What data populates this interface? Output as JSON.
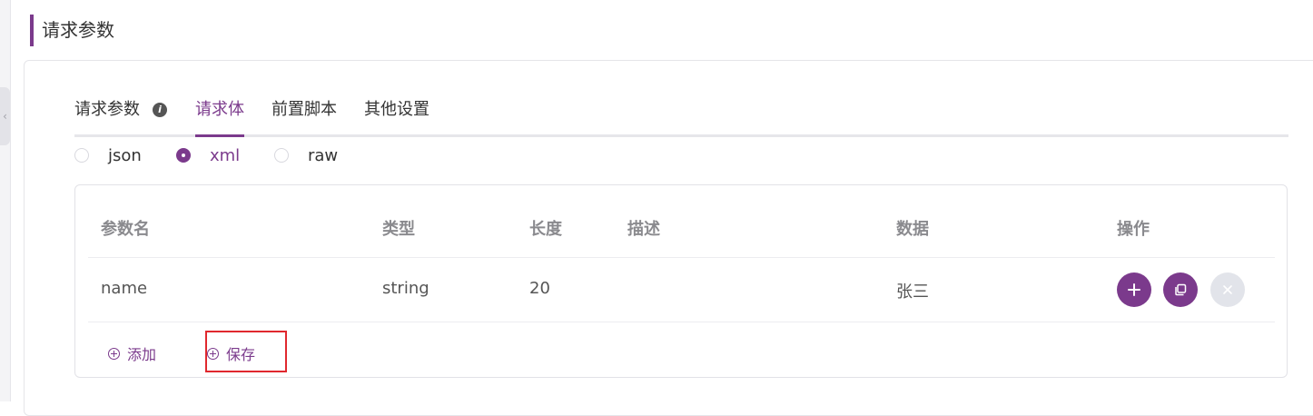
{
  "section": {
    "title": "请求参数"
  },
  "tabs": [
    {
      "label": "请求参数",
      "active": false
    },
    {
      "label": "请求体",
      "active": true
    },
    {
      "label": "前置脚本",
      "active": false
    },
    {
      "label": "其他设置",
      "active": false
    }
  ],
  "body_type": {
    "options": [
      "json",
      "xml",
      "raw"
    ],
    "selected": "xml"
  },
  "table": {
    "headers": [
      "参数名",
      "类型",
      "长度",
      "描述",
      "数据",
      "操作"
    ],
    "rows": [
      {
        "name": "name",
        "type": "string",
        "length": "20",
        "description": "",
        "data": "张三"
      }
    ]
  },
  "actions": {
    "add_label": "添加",
    "save_label": "保存"
  },
  "colors": {
    "accent": "#7b3a8c",
    "highlight": "#e0282e",
    "disabled": "#e2e4ea"
  }
}
